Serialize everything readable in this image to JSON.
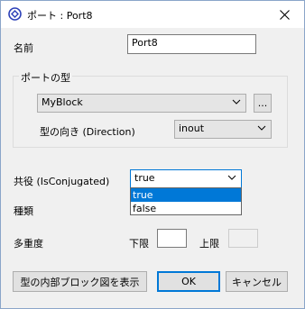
{
  "window": {
    "title": "ポート : Port8"
  },
  "name": {
    "label": "名前",
    "value": "Port8"
  },
  "port_type": {
    "group_label": "ポートの型",
    "block_value": "MyBlock",
    "browse_label": "...",
    "direction_label": "型の向き (Direction)",
    "direction_value": "inout"
  },
  "conjugated": {
    "label": "共役 (IsConjugated)",
    "value": "true",
    "options": [
      "true",
      "false"
    ],
    "selected_index": 0
  },
  "kind": {
    "label": "種類"
  },
  "multiplicity": {
    "label": "多重度",
    "lower_label": "下限",
    "lower_value": "",
    "upper_label": "上限",
    "upper_value": ""
  },
  "buttons": {
    "show_block_diagram": "型の内部ブロック図を表示",
    "ok": "OK",
    "cancel": "キャンセル"
  }
}
